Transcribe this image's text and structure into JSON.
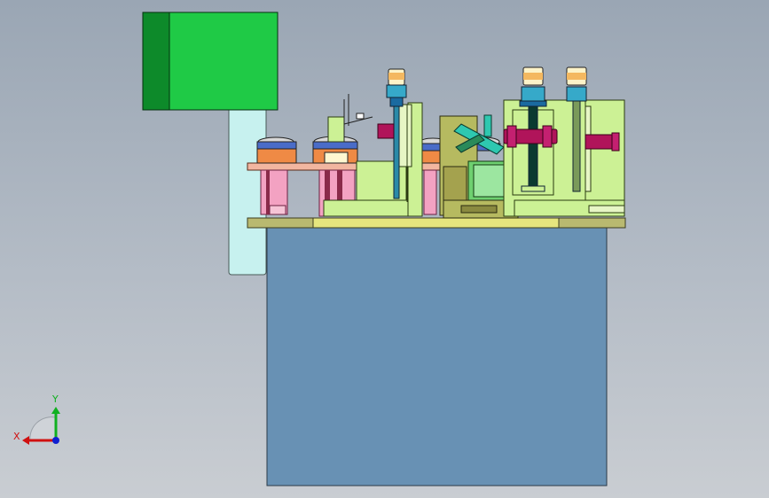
{
  "app": {
    "view": "front-orthographic"
  },
  "triad": {
    "x_label": "X",
    "y_label": "Y"
  },
  "colors": {
    "background_top": "#9aa6b4",
    "cabinet_blue": "#6891b4",
    "motor_green": "#1fca46",
    "frame_lime": "#ccf195",
    "table_olive": "#b9b970",
    "duct_cyan": "#c7f1ef",
    "accent_magenta": "#b0145a",
    "accent_orange": "#ef8a45",
    "cylinder_cyan": "#36a9c9",
    "axis_red": "#d01010",
    "axis_green": "#10b020",
    "axis_blue": "#1020d0"
  },
  "icons": {
    "triad": "coordinate-triad-icon"
  }
}
